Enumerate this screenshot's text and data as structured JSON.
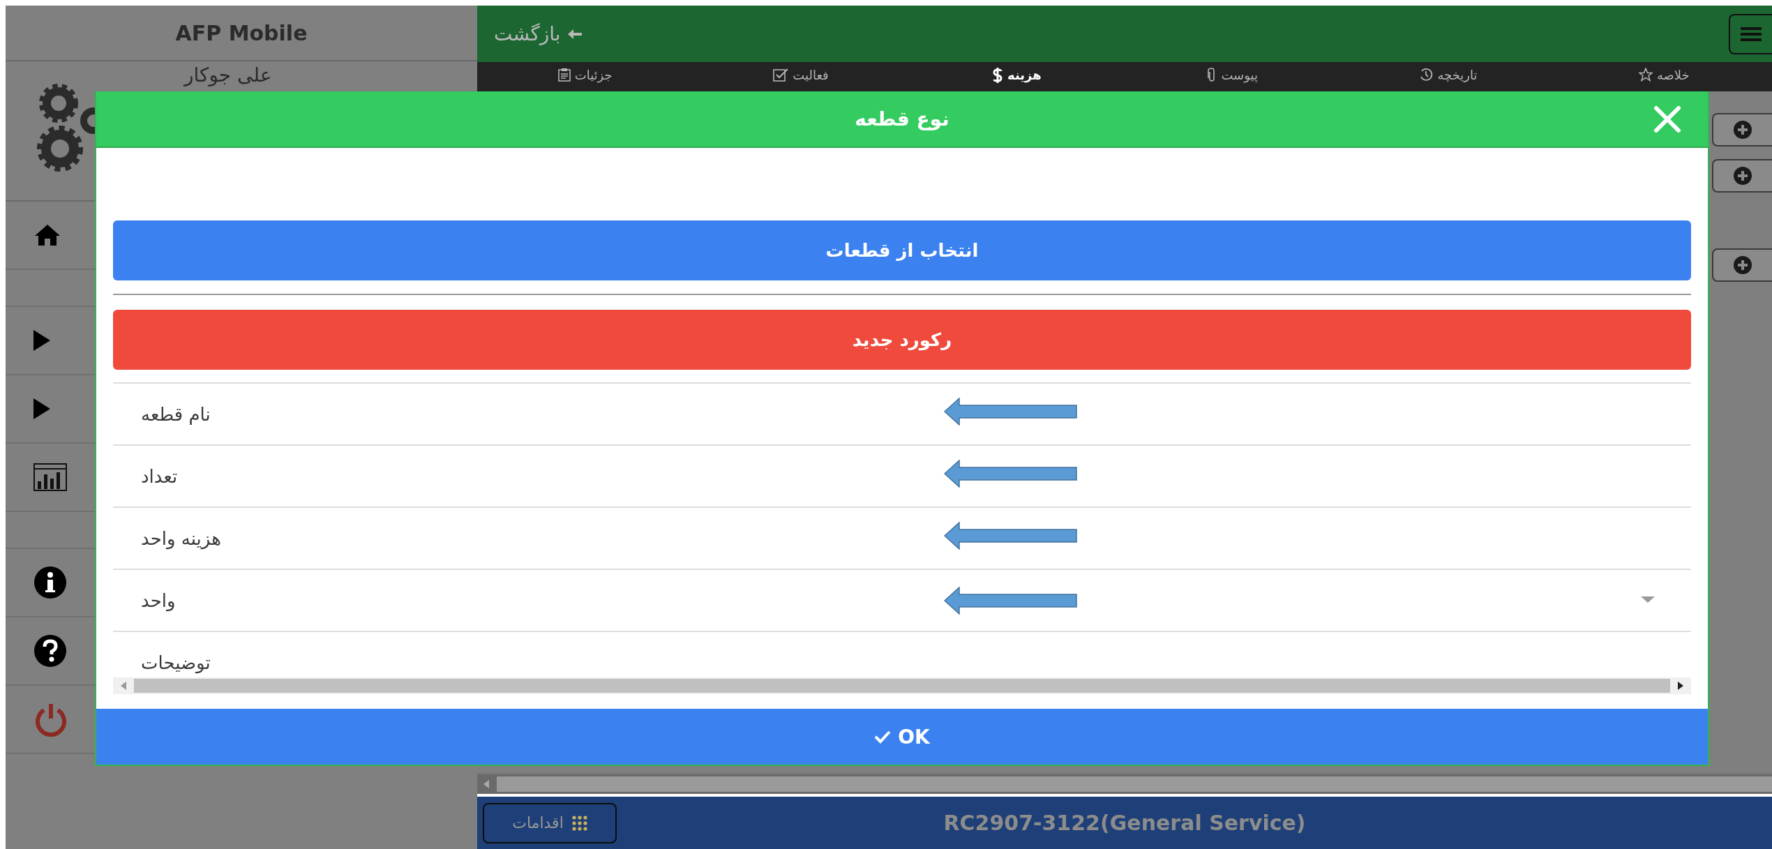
{
  "sidebar": {
    "title": "AFP Mobile",
    "user": "علی جوکار",
    "items": [
      {
        "kind": "home"
      },
      {
        "kind": "spacer"
      },
      {
        "kind": "play"
      },
      {
        "kind": "play"
      },
      {
        "kind": "chart"
      },
      {
        "kind": "spacer"
      },
      {
        "kind": "info"
      },
      {
        "kind": "help"
      },
      {
        "kind": "power"
      }
    ]
  },
  "top_bar": {
    "back": "بازگشت"
  },
  "tabs": [
    {
      "label": "خلاصه",
      "kind": "star",
      "selected": false
    },
    {
      "label": "تاریخچه",
      "kind": "history",
      "selected": false
    },
    {
      "label": "پیوست",
      "kind": "paperclip",
      "selected": false
    },
    {
      "label": "هزینه",
      "kind": "dollar",
      "selected": true
    },
    {
      "label": "فعالیت",
      "kind": "check",
      "selected": false
    },
    {
      "label": "جزئیات",
      "kind": "clipboard",
      "selected": false
    }
  ],
  "add_buttons": [
    {
      "kind": "add"
    },
    {
      "kind": "add"
    },
    {
      "kind": "add"
    }
  ],
  "dialog": {
    "title": "نوع قطعه",
    "select_button": "انتخاب از قطعات",
    "new_button": "رکورد جدید",
    "fields": [
      {
        "label": "نام قطعه",
        "kind": "text",
        "arrow": true
      },
      {
        "label": "تعداد",
        "kind": "text",
        "arrow": true
      },
      {
        "label": "هزینه واحد",
        "kind": "text",
        "arrow": true
      },
      {
        "label": "واحد",
        "kind": "select",
        "arrow": true
      },
      {
        "label": "توضیحات",
        "kind": "text",
        "arrow": false
      }
    ],
    "ok_button": "OK"
  },
  "bottom_bar": {
    "actions": "اقدامات",
    "title": "RC2907-3122(General Service)"
  }
}
